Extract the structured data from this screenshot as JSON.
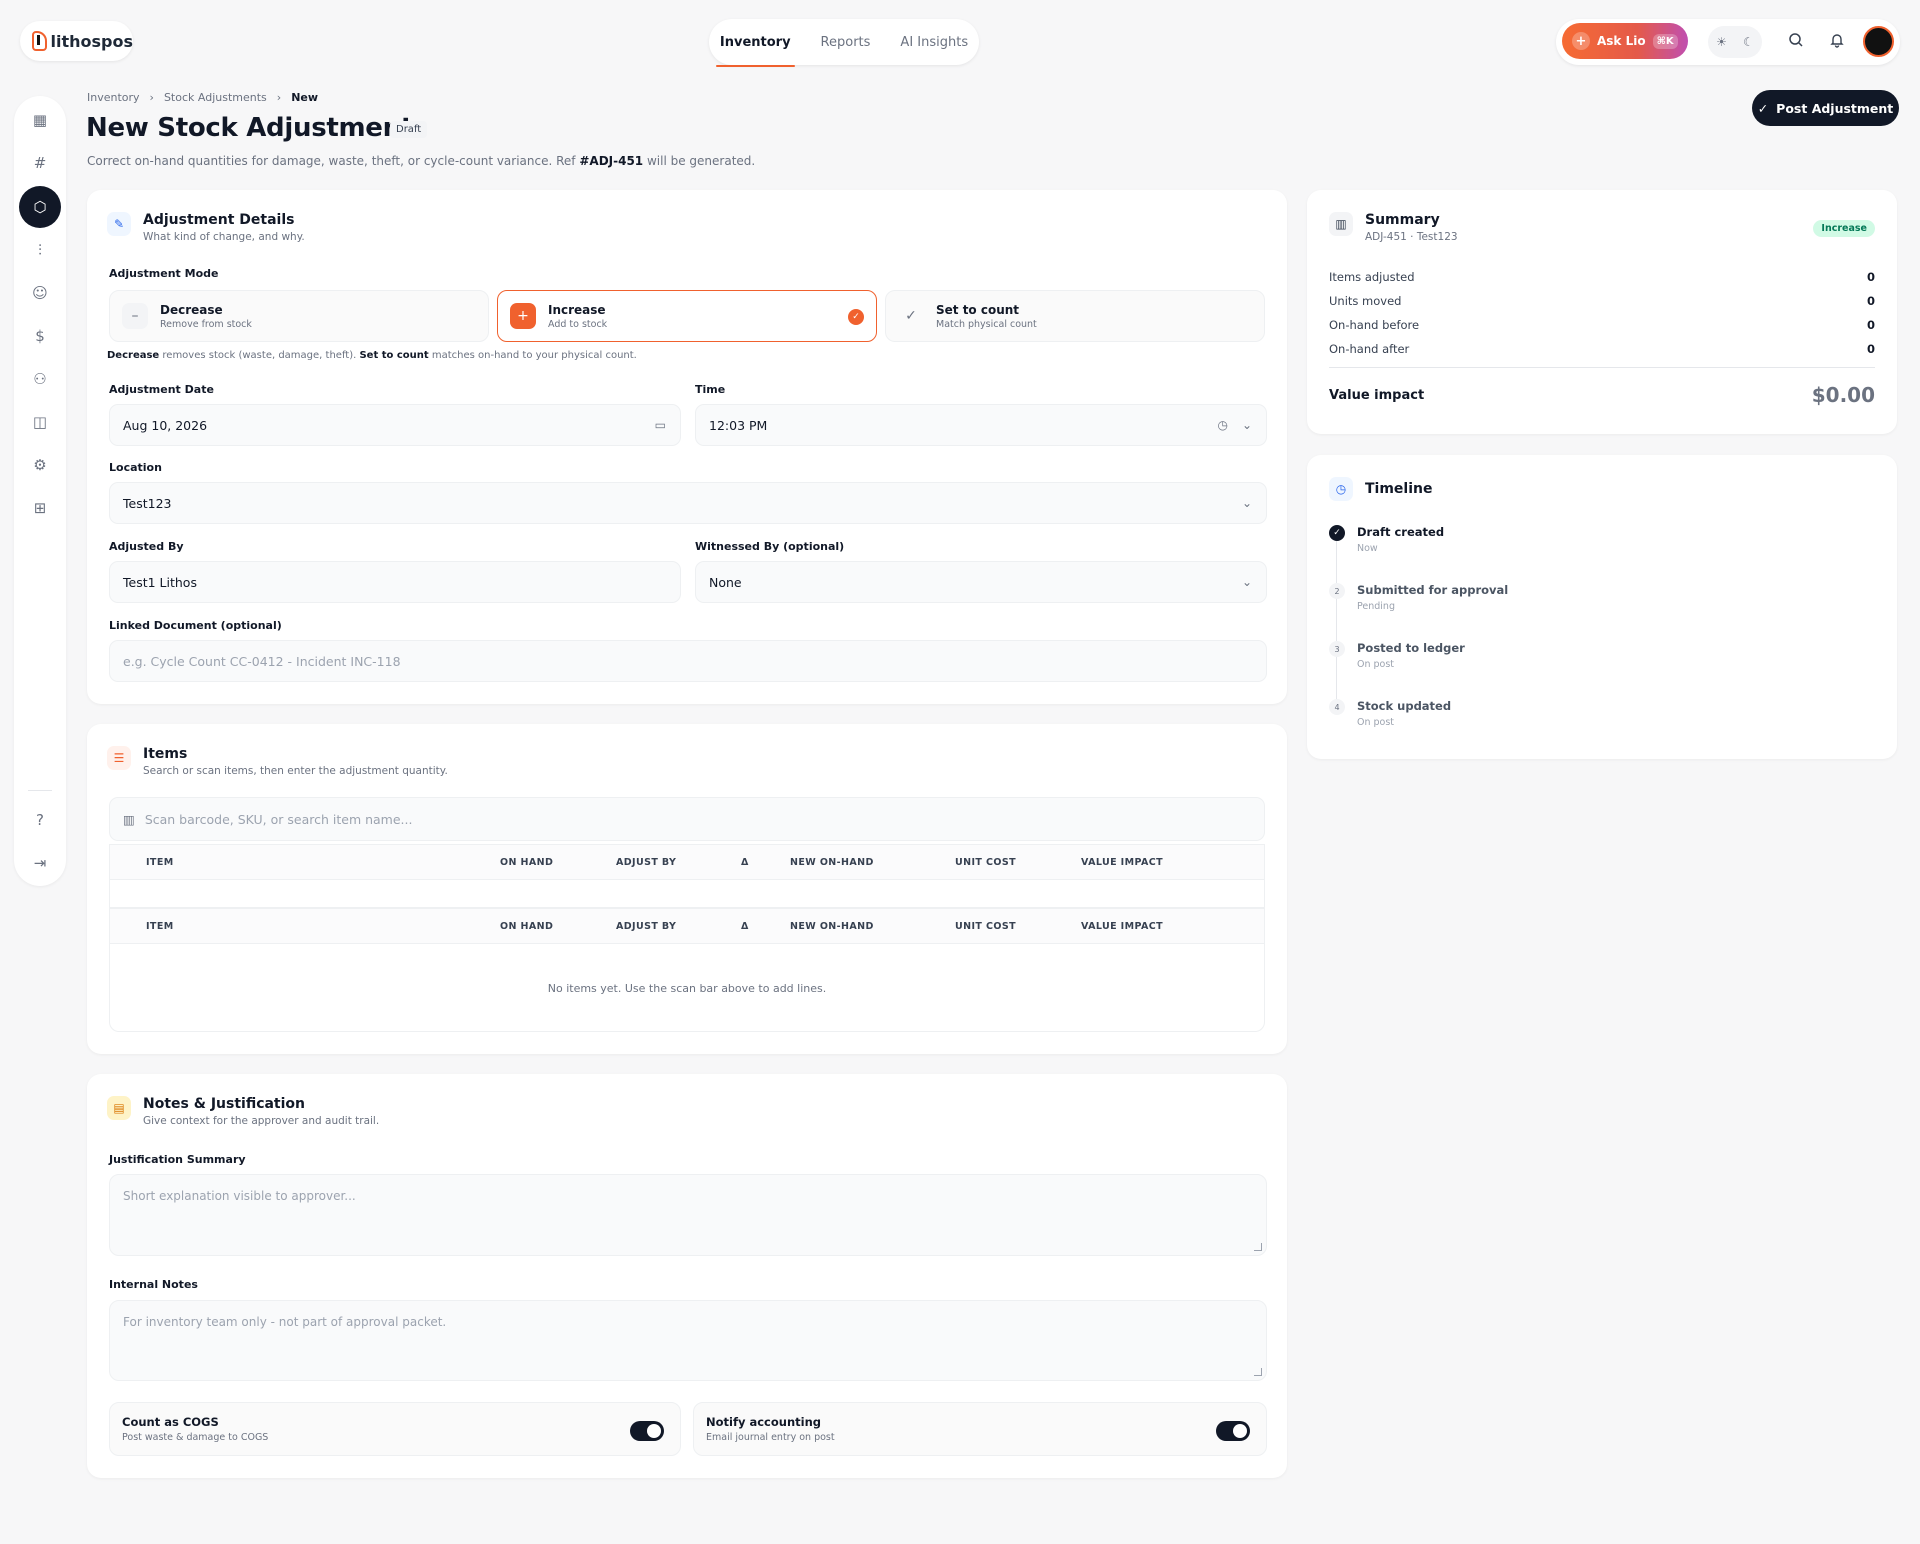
{
  "brand": {
    "name": "lithospos"
  },
  "topnav": {
    "items": [
      "Inventory",
      "Reports",
      "AI Insights"
    ],
    "active": "Inventory"
  },
  "toolbar": {
    "ask_label": "Ask Lio",
    "ask_shortcut": "⌘K"
  },
  "breadcrumb": [
    "Inventory",
    "Stock Adjustments",
    "New"
  ],
  "page": {
    "title": "New Stock Adjustment",
    "status": "Draft",
    "subtitle_pre": "Correct on-hand quantities for damage, waste, theft, or cycle-count variance. Ref ",
    "ref": "#ADJ-451",
    "subtitle_post": " will be generated.",
    "post_button": "Post Adjustment"
  },
  "details": {
    "title": "Adjustment Details",
    "subtitle": "What kind of change, and why.",
    "mode_label": "Adjustment Mode",
    "modes": [
      {
        "title": "Decrease",
        "sub": "Remove from stock",
        "icon": "minus-icon",
        "selected": false
      },
      {
        "title": "Increase",
        "sub": "Add to stock",
        "icon": "plus-icon",
        "selected": true
      },
      {
        "title": "Set to count",
        "sub": "Match physical count",
        "icon": "check-icon",
        "selected": false
      }
    ],
    "hint": {
      "b1": "Decrease",
      "t1": " removes stock (waste, damage, theft). ",
      "b2": "Set to count",
      "t2": " matches on-hand to your physical count."
    },
    "date_label": "Adjustment Date",
    "date_value": "Aug 10, 2026",
    "time_label": "Time",
    "time_value": "12:03 PM",
    "location_label": "Location",
    "location_value": "Test123",
    "adjusted_by_label": "Adjusted By",
    "adjusted_by_value": "Test1 Lithos",
    "witness_label": "Witnessed By (optional)",
    "witness_value": "None",
    "linked_label": "Linked Document (optional)",
    "linked_placeholder": "e.g. Cycle Count CC-0412 - Incident INC-118"
  },
  "items": {
    "title": "Items",
    "subtitle": "Search or scan items, then enter the adjustment quantity.",
    "search_placeholder": "Scan barcode, SKU, or search item name...",
    "columns": [
      "ITEM",
      "ON HAND",
      "ADJUST BY",
      "Δ",
      "NEW ON-HAND",
      "UNIT COST",
      "VALUE IMPACT"
    ],
    "empty": "No items yet. Use the scan bar above to add lines."
  },
  "notes": {
    "title": "Notes & Justification",
    "subtitle": "Give context for the approver and audit trail.",
    "summary_label": "Justification Summary",
    "summary_placeholder": "Short explanation visible to approver...",
    "internal_label": "Internal Notes",
    "internal_placeholder": "For inventory team only - not part of approval packet.",
    "toggles": [
      {
        "title": "Count as COGS",
        "sub": "Post waste & damage to COGS",
        "on": true
      },
      {
        "title": "Notify accounting",
        "sub": "Email journal entry on post",
        "on": true
      }
    ]
  },
  "summary": {
    "title": "Summary",
    "subtitle": "ADJ-451 · Test123",
    "badge": "Increase",
    "rows": [
      [
        "Items adjusted",
        "0"
      ],
      [
        "Units moved",
        "0"
      ],
      [
        "On-hand before",
        "0"
      ],
      [
        "On-hand after",
        "0"
      ]
    ],
    "value_label": "Value impact",
    "value": "$0.00"
  },
  "timeline": {
    "title": "Timeline",
    "steps": [
      {
        "n": "✓",
        "title": "Draft created",
        "sub": "Now",
        "done": true
      },
      {
        "n": "2",
        "title": "Submitted for approval",
        "sub": "Pending",
        "done": false
      },
      {
        "n": "3",
        "title": "Posted to ledger",
        "sub": "On post",
        "done": false
      },
      {
        "n": "4",
        "title": "Stock updated",
        "sub": "On post",
        "done": false
      }
    ]
  },
  "colors": {
    "accent": "#f0612e",
    "dark": "#111827",
    "success_bg": "#d1fae5"
  }
}
